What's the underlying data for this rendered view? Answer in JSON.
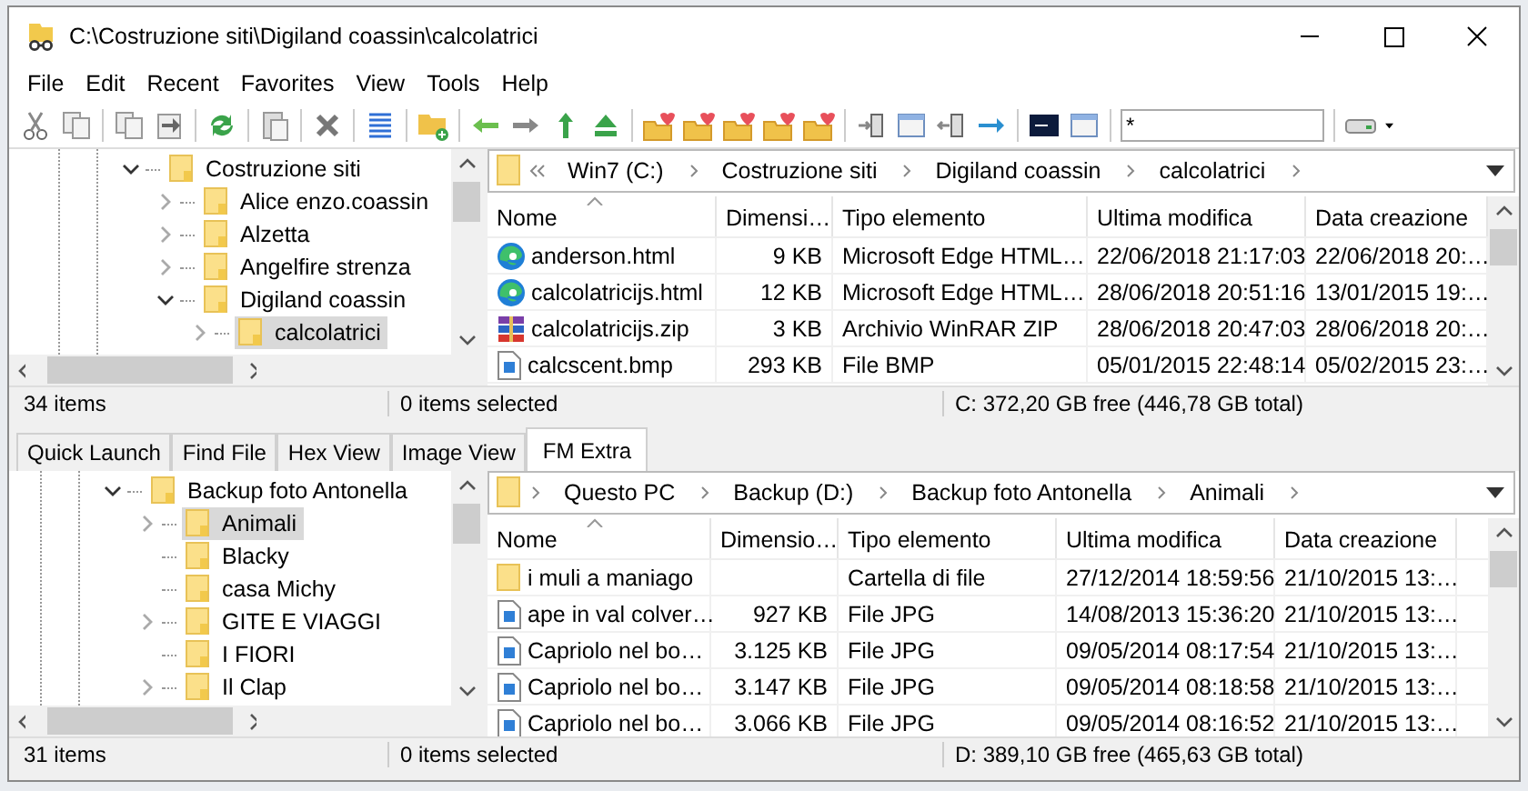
{
  "window": {
    "title": "C:\\Costruzione siti\\Digiland coassin\\calcolatrici"
  },
  "menu": [
    "File",
    "Edit",
    "Recent",
    "Favorites",
    "View",
    "Tools",
    "Help"
  ],
  "toolbar": {
    "filter": {
      "value": "*"
    }
  },
  "top_pane": {
    "tree": [
      {
        "label": "Costruzione siti",
        "expanded": true,
        "selected": false,
        "children": [
          {
            "label": "Alice enzo.coassin",
            "expanded": false,
            "selected": false
          },
          {
            "label": "Alzetta",
            "expanded": false,
            "selected": false
          },
          {
            "label": "Angelfire strenza",
            "expanded": false,
            "selected": false
          },
          {
            "label": "Digiland coassin",
            "expanded": true,
            "selected": false,
            "children": [
              {
                "label": "calcolatrici",
                "expanded": false,
                "selected": true
              }
            ]
          }
        ]
      }
    ],
    "breadcrumb": {
      "overflow": true,
      "parts": [
        "Win7 (C:)",
        "Costruzione siti",
        "Digiland coassin",
        "calcolatrici"
      ]
    },
    "columns": [
      "Nome",
      "Dimensi…",
      "Tipo elemento",
      "Ultima modifica",
      "Data creazione"
    ],
    "rows": [
      {
        "kind": "edge",
        "name": "anderson.html",
        "size": "9 KB",
        "type": "Microsoft Edge HTML…",
        "modified": "22/06/2018 21:17:03",
        "created": "22/06/2018 20:…"
      },
      {
        "kind": "edge",
        "name": "calcolatricijs.html",
        "size": "12 KB",
        "type": "Microsoft Edge HTML…",
        "modified": "28/06/2018 20:51:16",
        "created": "13/01/2015 19:…"
      },
      {
        "kind": "archive",
        "name": "calcolatricijs.zip",
        "size": "3 KB",
        "type": "Archivio WinRAR ZIP",
        "modified": "28/06/2018 20:47:03",
        "created": "28/06/2018 20:…"
      },
      {
        "kind": "image",
        "name": "calcscent.bmp",
        "size": "293 KB",
        "type": "File BMP",
        "modified": "05/01/2015 22:48:14",
        "created": "05/02/2015 23:…"
      }
    ],
    "status": [
      "34 items",
      "0 items selected",
      "C: 372,20 GB free (446,78 GB total)"
    ]
  },
  "tabs": [
    {
      "label": "Quick Launch",
      "selected": false
    },
    {
      "label": "Find File",
      "selected": false
    },
    {
      "label": "Hex View",
      "selected": false
    },
    {
      "label": "Image View",
      "selected": false
    },
    {
      "label": "FM Extra",
      "selected": true
    }
  ],
  "bottom_pane": {
    "tree": [
      {
        "label": "Backup foto Antonella",
        "expanded": true,
        "selected": false,
        "children": [
          {
            "label": "Animali",
            "expanded": false,
            "selected": true
          },
          {
            "label": "Blacky",
            "selected": false
          },
          {
            "label": "casa Michy",
            "selected": false
          },
          {
            "label": "GITE E VIAGGI",
            "expanded": false,
            "selected": false
          },
          {
            "label": "I FIORI",
            "selected": false
          },
          {
            "label": "Il Clap",
            "expanded": false,
            "selected": false
          }
        ]
      }
    ],
    "breadcrumb": {
      "overflow": false,
      "parts": [
        "Questo PC",
        "Backup (D:)",
        "Backup foto Antonella",
        "Animali"
      ]
    },
    "columns": [
      "Nome",
      "Dimensio…",
      "Tipo elemento",
      "Ultima modifica",
      "Data creazione"
    ],
    "rows": [
      {
        "kind": "folder",
        "name": "i muli a maniago",
        "type": "Cartella di file",
        "modified": "27/12/2014 18:59:56",
        "created": "21/10/2015 13:…"
      },
      {
        "kind": "image",
        "name": "ape in val colver…",
        "size": "927 KB",
        "type": "File JPG",
        "modified": "14/08/2013 15:36:20",
        "created": "21/10/2015 13:…"
      },
      {
        "kind": "image",
        "name": "Capriolo nel bo…",
        "size": "3.125 KB",
        "type": "File JPG",
        "modified": "09/05/2014 08:17:54",
        "created": "21/10/2015 13:…"
      },
      {
        "kind": "image",
        "name": "Capriolo nel bo…",
        "size": "3.147 KB",
        "type": "File JPG",
        "modified": "09/05/2014 08:18:58",
        "created": "21/10/2015 13:…"
      },
      {
        "kind": "image",
        "name": "Capriolo nel bo…",
        "size": "3.066 KB",
        "type": "File JPG",
        "modified": "09/05/2014 08:16:52",
        "created": "21/10/2015 13:…"
      }
    ],
    "status": [
      "31 items",
      "0 items selected",
      "D: 389,10 GB free (465,63 GB total)"
    ]
  }
}
